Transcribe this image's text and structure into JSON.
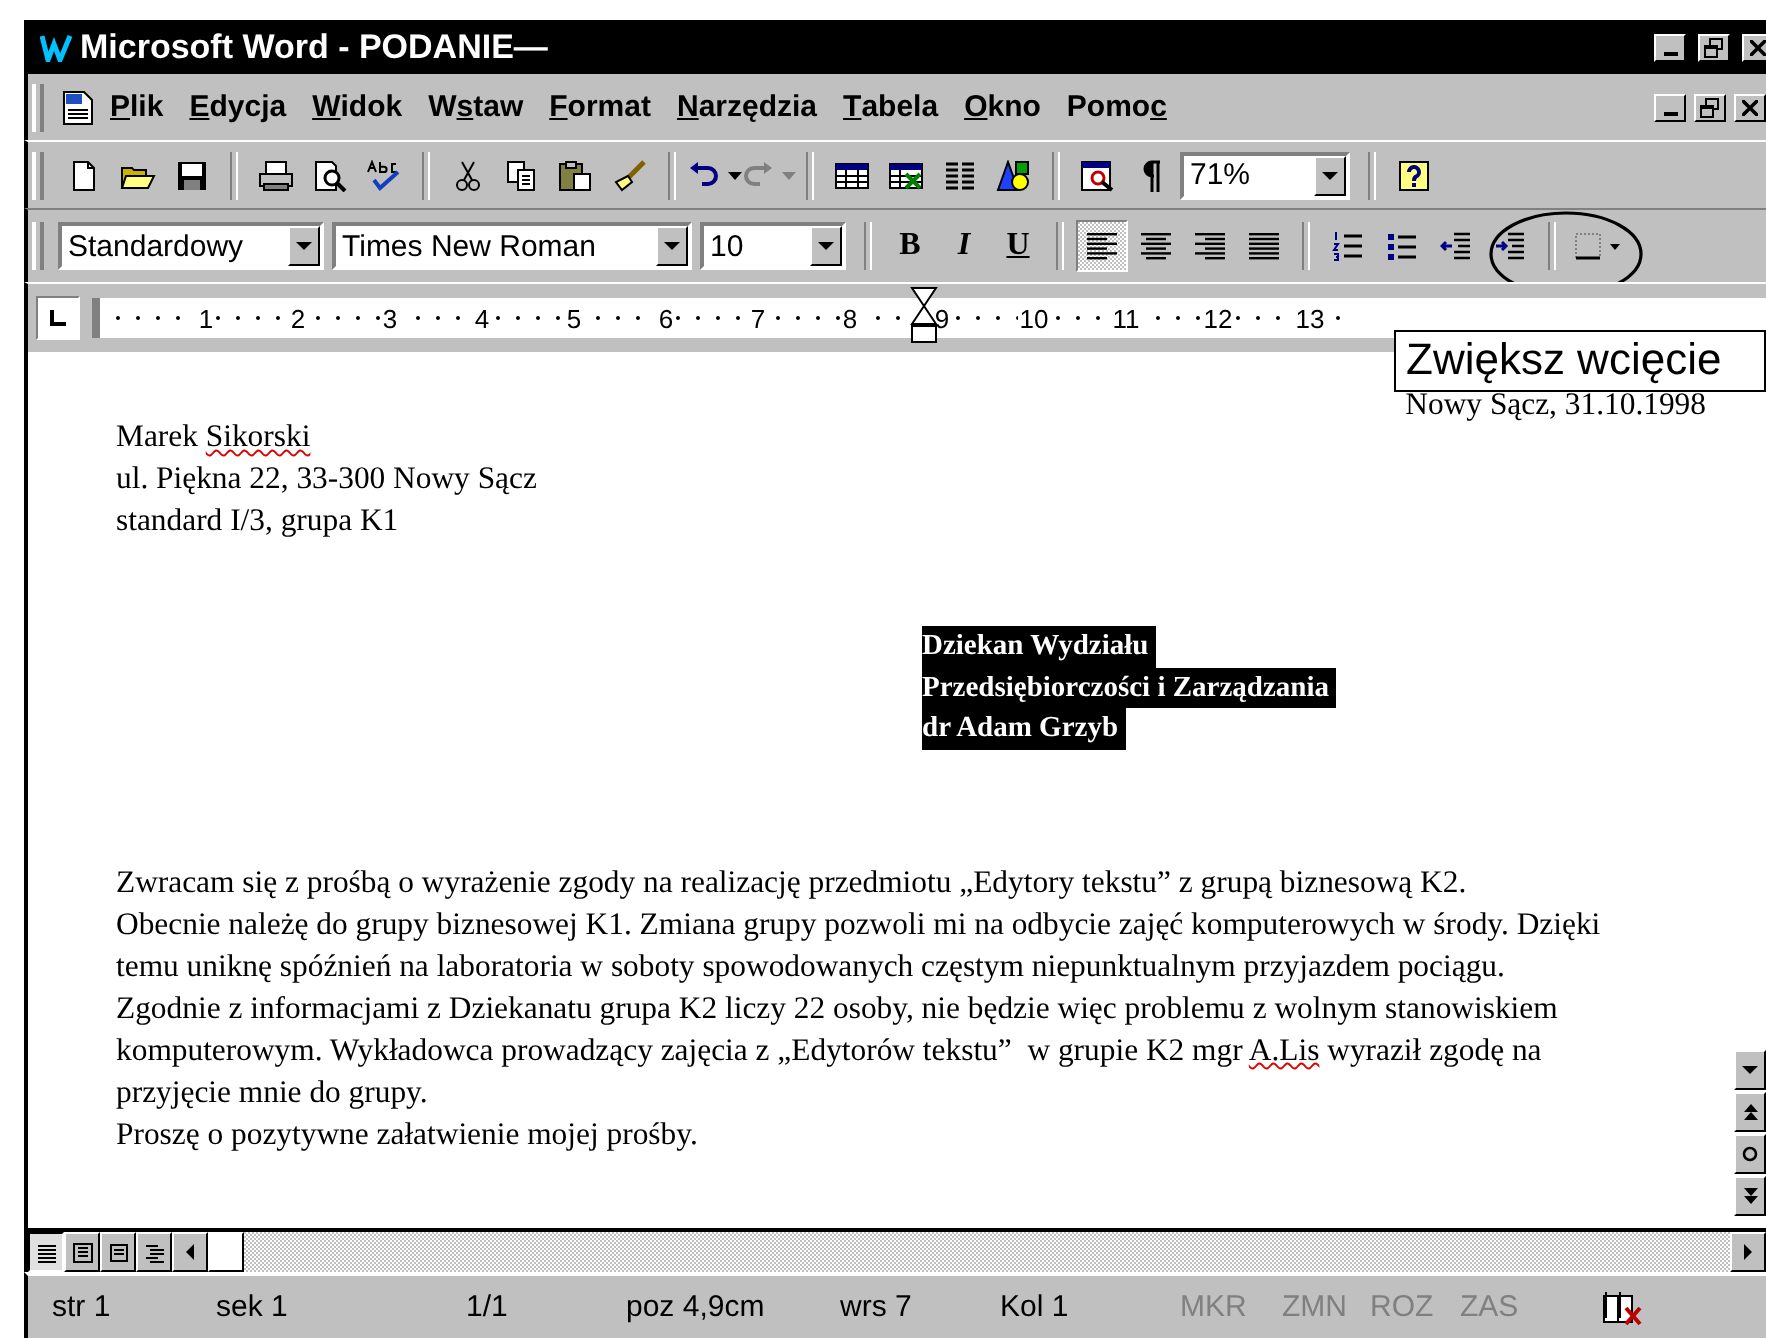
{
  "window": {
    "title": "Microsoft Word - PODANIE—"
  },
  "menu": [
    {
      "parts": [
        {
          "text": "P",
          "underlined": true
        },
        {
          "text": "lik",
          "underlined": false
        }
      ]
    },
    {
      "parts": [
        {
          "text": "E",
          "underlined": true
        },
        {
          "text": "dycja",
          "underlined": false
        }
      ]
    },
    {
      "parts": [
        {
          "text": "W",
          "underlined": true
        },
        {
          "text": "idok",
          "underlined": false
        }
      ]
    },
    {
      "parts": [
        {
          "text": "W",
          "underlined": false
        },
        {
          "text": "s",
          "underlined": true
        },
        {
          "text": "taw",
          "underlined": false
        }
      ]
    },
    {
      "parts": [
        {
          "text": "F",
          "underlined": true
        },
        {
          "text": "ormat",
          "underlined": false
        }
      ]
    },
    {
      "parts": [
        {
          "text": "N",
          "underlined": true
        },
        {
          "text": "arzędzia",
          "underlined": false
        }
      ]
    },
    {
      "parts": [
        {
          "text": "T",
          "underlined": true
        },
        {
          "text": "abela",
          "underlined": false
        }
      ]
    },
    {
      "parts": [
        {
          "text": "O",
          "underlined": true
        },
        {
          "text": "kno",
          "underlined": false
        }
      ]
    },
    {
      "parts": [
        {
          "text": "Pomo",
          "underlined": false
        },
        {
          "text": "c",
          "underlined": true
        }
      ]
    }
  ],
  "standard_toolbar": [
    {
      "kind": "new"
    },
    {
      "kind": "open"
    },
    {
      "kind": "save"
    },
    {
      "kind": "sep"
    },
    {
      "kind": "print"
    },
    {
      "kind": "preview"
    },
    {
      "kind": "spelling"
    },
    {
      "kind": "sep"
    },
    {
      "kind": "cut"
    },
    {
      "kind": "copy"
    },
    {
      "kind": "paste"
    },
    {
      "kind": "painter"
    },
    {
      "kind": "sep"
    },
    {
      "kind": "undo",
      "disabled": false
    },
    {
      "kind": "redo",
      "disabled": true
    },
    {
      "kind": "sep"
    },
    {
      "kind": "table"
    },
    {
      "kind": "sheet"
    },
    {
      "kind": "columns"
    },
    {
      "kind": "drawing"
    },
    {
      "kind": "sep"
    },
    {
      "kind": "docmap"
    },
    {
      "kind": "pilcrow"
    }
  ],
  "zoom": {
    "value": "71%"
  },
  "formatting_toolbar": {
    "style": "Standardowy",
    "font": "Times New Roman",
    "size": "10",
    "text_buttons": [
      {
        "label": "B",
        "kind": "bold",
        "selected": false
      },
      {
        "label": "I",
        "kind": "italic",
        "selected": false
      },
      {
        "label": "U",
        "kind": "underline",
        "selected": false
      }
    ],
    "align_buttons": [
      {
        "kind": "left",
        "selected": true
      },
      {
        "kind": "center",
        "selected": false
      },
      {
        "kind": "right",
        "selected": false
      },
      {
        "kind": "justify",
        "selected": false
      }
    ],
    "list_buttons": [
      {
        "kind": "numbering"
      },
      {
        "kind": "bullets"
      },
      {
        "kind": "outdent"
      },
      {
        "kind": "indent"
      }
    ]
  },
  "ruler": {
    "labels": [
      "1",
      "2",
      "3",
      "4",
      "5",
      "6",
      "7",
      "8",
      "9",
      "10",
      "11",
      "12",
      "13"
    ]
  },
  "tooltip": {
    "text": "Zwiększ wcięcie"
  },
  "document": {
    "date": "Nowy Sącz, 31.10.1998",
    "sender": [
      [
        {
          "text": "Marek ",
          "misspelled": false
        },
        {
          "text": "Sikorski",
          "misspelled": true
        }
      ],
      [
        {
          "text": "ul. Piękna 22, 33-300 Nowy Sącz",
          "misspelled": false
        }
      ],
      [
        {
          "text": "standard I/3, grupa K1",
          "misspelled": false
        }
      ]
    ],
    "recipient": {
      "selected": true,
      "lines": [
        "Dziekan Wydziału ",
        "Przedsiębiorczości i Zarządzania ",
        "dr Adam Grzyb "
      ]
    },
    "body": [
      [
        {
          "text": "Zwracam się z prośbą o wyrażenie zgody na realizację przedmiotu „Edytory tekstu” z grupą biznesową K2.",
          "misspelled": false
        }
      ],
      [
        {
          "text": "Obecnie należę do grupy biznesowej K1. Zmiana grupy pozwoli mi na odbycie zajęć komputerowych w środy. Dzięki",
          "misspelled": false
        }
      ],
      [
        {
          "text": "temu uniknę spóźnień na laboratoria w soboty spowodowanych częstym niepunktualnym przyjazdem pociągu.",
          "misspelled": false
        }
      ],
      [
        {
          "text": "Zgodnie z informacjami z Dziekanatu grupa K2 liczy 22 osoby, nie będzie więc problemu z wolnym stanowiskiem",
          "misspelled": false
        }
      ],
      [
        {
          "text": "komputerowym. Wykładowca prowadzący zajęcia z „Edytorów tekstu”  w grupie K2 mgr ",
          "misspelled": false
        },
        {
          "text": "A.Lis",
          "misspelled": true
        },
        {
          "text": " wyraził zgodę na",
          "misspelled": false
        }
      ],
      [
        {
          "text": "przyjęcie mnie do grupy.",
          "misspelled": false
        }
      ],
      [
        {
          "text": "Proszę o pozytywne załatwienie mojej prośby.",
          "misspelled": false
        }
      ]
    ]
  },
  "view_buttons": [
    {
      "kind": "normal",
      "selected": true
    },
    {
      "kind": "online",
      "selected": false
    },
    {
      "kind": "page",
      "selected": false
    },
    {
      "kind": "outline",
      "selected": false
    }
  ],
  "status_bar": [
    {
      "text": "str 1",
      "disabled": false
    },
    {
      "text": "sek 1",
      "disabled": false
    },
    {
      "text": "1/1",
      "disabled": false
    },
    {
      "text": "poz 4,9cm",
      "disabled": false
    },
    {
      "text": "wrs 7",
      "disabled": false
    },
    {
      "text": "Kol 1",
      "disabled": false
    },
    {
      "text": "MKR",
      "disabled": true
    },
    {
      "text": "ZMN",
      "disabled": true
    },
    {
      "text": "ROZ",
      "disabled": true
    },
    {
      "text": "ZAS",
      "disabled": true
    }
  ]
}
